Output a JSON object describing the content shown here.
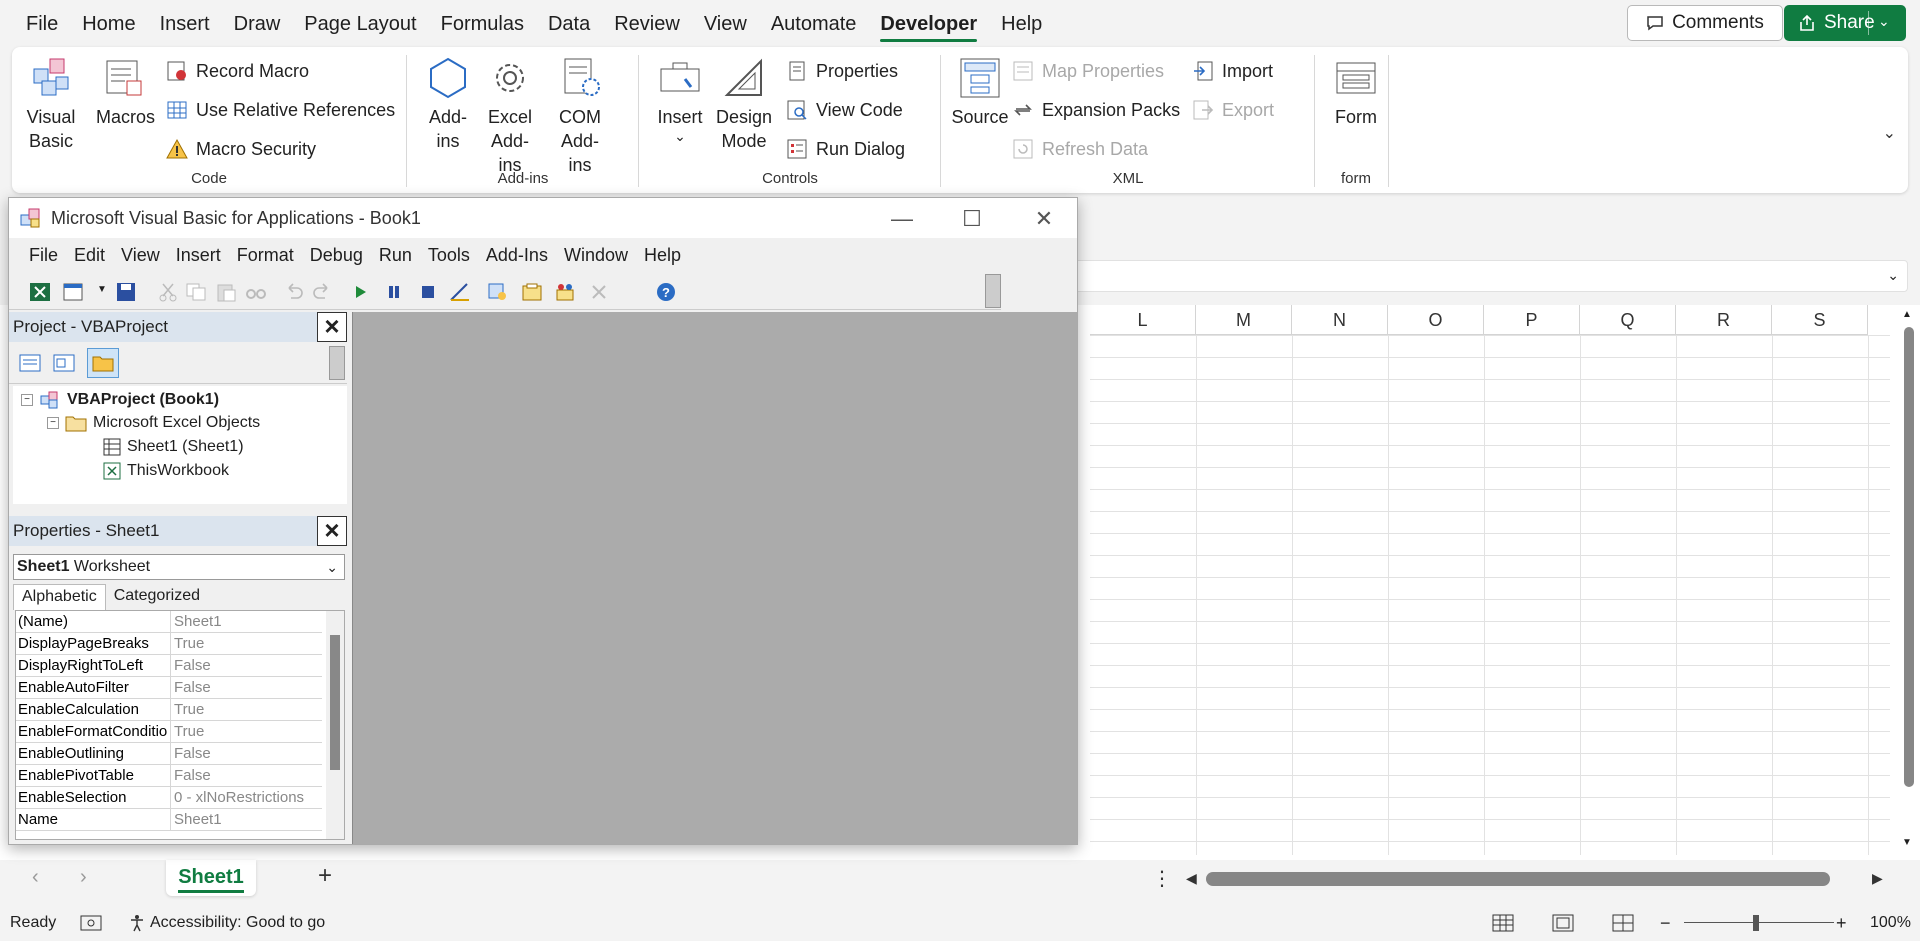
{
  "menubar": {
    "tabs": [
      "File",
      "Home",
      "Insert",
      "Draw",
      "Page Layout",
      "Formulas",
      "Data",
      "Review",
      "View",
      "Automate",
      "Developer",
      "Help"
    ],
    "active": "Developer",
    "comments_label": "Comments",
    "share_label": "Share"
  },
  "ribbon": {
    "code": {
      "label": "Code",
      "visual_basic": "Visual Basic",
      "macros": "Macros",
      "record_macro": "Record Macro",
      "relative_refs": "Use Relative References",
      "macro_security": "Macro Security"
    },
    "addins": {
      "label": "Add-ins",
      "addins": "Add-ins",
      "excel_addins": "Excel Add-ins",
      "com_addins": "COM Add-ins"
    },
    "controls": {
      "label": "Controls",
      "insert": "Insert",
      "design_mode": "Design Mode",
      "properties": "Properties",
      "view_code": "View Code",
      "run_dialog": "Run Dialog"
    },
    "xml": {
      "label": "XML",
      "source": "Source",
      "map_properties": "Map Properties",
      "expansion_packs": "Expansion Packs",
      "refresh_data": "Refresh Data",
      "import": "Import",
      "export": "Export"
    },
    "form": {
      "label": "form",
      "form": "Form"
    }
  },
  "sheet": {
    "columns": [
      "L",
      "M",
      "N",
      "O",
      "P",
      "Q",
      "R",
      "S"
    ],
    "tab": "Sheet1"
  },
  "statusbar": {
    "ready": "Ready",
    "accessibility": "Accessibility: Good to go",
    "zoom": "100%"
  },
  "vba": {
    "title": "Microsoft Visual Basic for Applications - Book1",
    "menu": [
      "File",
      "Edit",
      "View",
      "Insert",
      "Format",
      "Debug",
      "Run",
      "Tools",
      "Add-Ins",
      "Window",
      "Help"
    ],
    "project_title": "Project - VBAProject",
    "tree": {
      "root": "VBAProject (Book1)",
      "folder": "Microsoft Excel Objects",
      "sheet": "Sheet1 (Sheet1)",
      "workbook": "ThisWorkbook"
    },
    "properties_title": "Properties - Sheet1",
    "object_name": "Sheet1",
    "object_type": "Worksheet",
    "tabs": [
      "Alphabetic",
      "Categorized"
    ],
    "props": [
      {
        "name": "(Name)",
        "value": "Sheet1"
      },
      {
        "name": "DisplayPageBreaks",
        "value": "True"
      },
      {
        "name": "DisplayRightToLeft",
        "value": "False"
      },
      {
        "name": "EnableAutoFilter",
        "value": "False"
      },
      {
        "name": "EnableCalculation",
        "value": "True"
      },
      {
        "name": "EnableFormatConditionsCalculation",
        "value": "True"
      },
      {
        "name": "EnableOutlining",
        "value": "False"
      },
      {
        "name": "EnablePivotTable",
        "value": "False"
      },
      {
        "name": "EnableSelection",
        "value": "0 - xlNoRestrictions"
      },
      {
        "name": "Name",
        "value": "Sheet1"
      }
    ]
  }
}
